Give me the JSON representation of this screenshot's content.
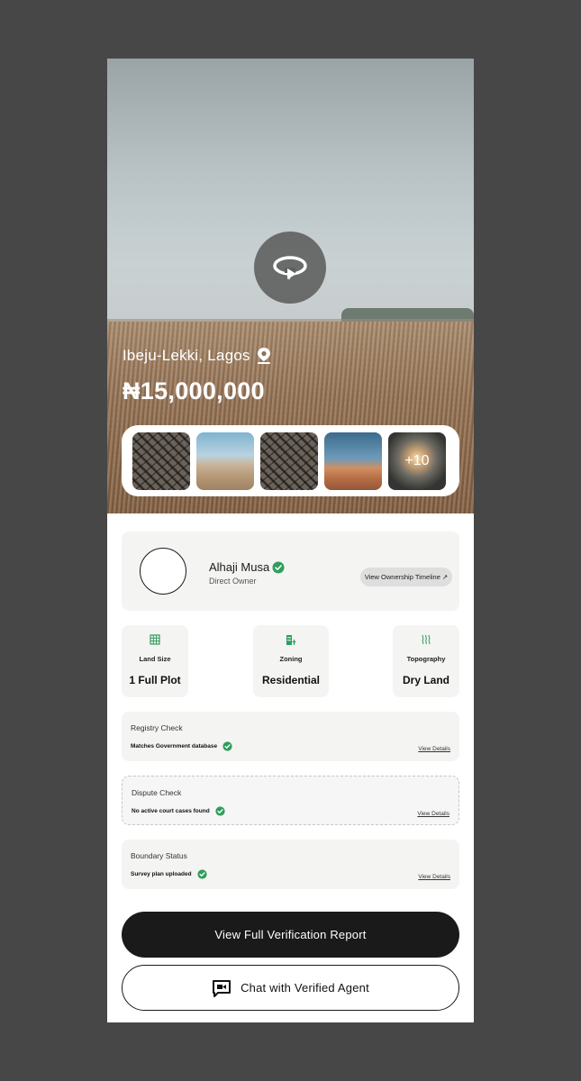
{
  "hero": {
    "location": "Ibeju-Lekki, Lagos",
    "price": "₦15,000,000",
    "gallery_more": "+10"
  },
  "owner": {
    "name": "Alhaji Musa",
    "role": "Direct Owner",
    "timeline_button": "View Ownership Timeline"
  },
  "stats": [
    {
      "label": "Land Size",
      "value": "1 Full Plot",
      "icon": "grid-icon"
    },
    {
      "label": "Zoning",
      "value": "Residential",
      "icon": "building-icon"
    },
    {
      "label": "Topography",
      "value": "Dry Land",
      "icon": "heat-waves-icon"
    }
  ],
  "checks": [
    {
      "title": "Registry Check",
      "status": "Matches Government database",
      "link": "View Details"
    },
    {
      "title": "Dispute Check",
      "status": "No active court cases found",
      "link": "View Details"
    },
    {
      "title": "Boundary Status",
      "status": "Survey plan uploaded",
      "link": "View Details"
    }
  ],
  "actions": {
    "primary": "View Full Verification Report",
    "secondary": "Chat with Verified Agent"
  },
  "colors": {
    "accent_green": "#2e9e5b",
    "dark": "#1a1a1a",
    "card_bg": "#f4f4f3"
  }
}
